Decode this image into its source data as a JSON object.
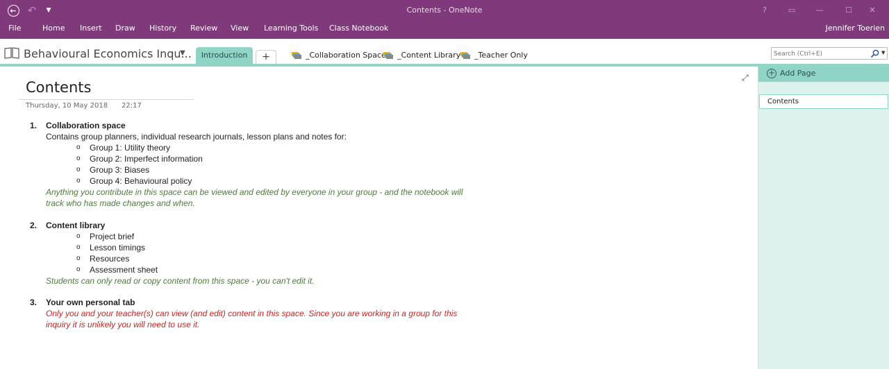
{
  "window": {
    "title": "Contents - OneNote",
    "help_label": "?",
    "ribbon_display_glyph": "▭",
    "minimize_glyph": "—",
    "maximize_glyph": "☐",
    "close_glyph": "✕"
  },
  "ribbon": {
    "tabs": [
      "File",
      "Home",
      "Insert",
      "Draw",
      "History",
      "Review",
      "View",
      "Learning Tools",
      "Class Notebook"
    ],
    "user": "Jennifer Toerien"
  },
  "notebook": {
    "name": "Behavioural Economics Inqu...",
    "active_section": "Introduction",
    "add_section_label": "+",
    "section_groups": [
      "_Collaboration Space",
      "_Content Library",
      "_Teacher Only"
    ],
    "search_placeholder": "Search (Ctrl+E)"
  },
  "page": {
    "title": "Contents",
    "date": "Thursday, 10 May 2018",
    "time": "22:17",
    "sections": [
      {
        "number": "1.",
        "heading": "Collaboration space",
        "description": "Contains group planners, individual research journals, lesson plans and notes for:",
        "bullets": [
          "Group 1: Utility theory",
          "Group 2: Imperfect information",
          "Group 3: Biases",
          "Group 4: Behavioural policy"
        ],
        "note_lines": [
          "Anything you contribute in this space can be viewed and edited by everyone in your group - and the notebook will",
          "track who has made changes and when."
        ]
      },
      {
        "number": "2.",
        "heading": "Content library",
        "bullets": [
          "Project brief",
          "Lesson timings",
          "Resources",
          "Assessment sheet"
        ],
        "note_lines": [
          "Students can only read or copy content from this space - you can't edit it."
        ]
      },
      {
        "number": "3.",
        "heading": "Your own personal tab",
        "warning_lines": [
          "Only you and your teacher(s) can view (and edit) content in this space. Since you are working in a group for this",
          "inquiry it is unlikely you will need to use it."
        ]
      }
    ],
    "bullet_glyph": "o"
  },
  "pages_pane": {
    "add_page_label": "Add Page",
    "pages": [
      "Contents"
    ]
  },
  "colors": {
    "titlebar": "#80397b",
    "section_tab": "#8fd4c5",
    "pane_bg": "#ddf2ec",
    "note_green": "#4e7b3a",
    "warning_red": "#c72525"
  }
}
